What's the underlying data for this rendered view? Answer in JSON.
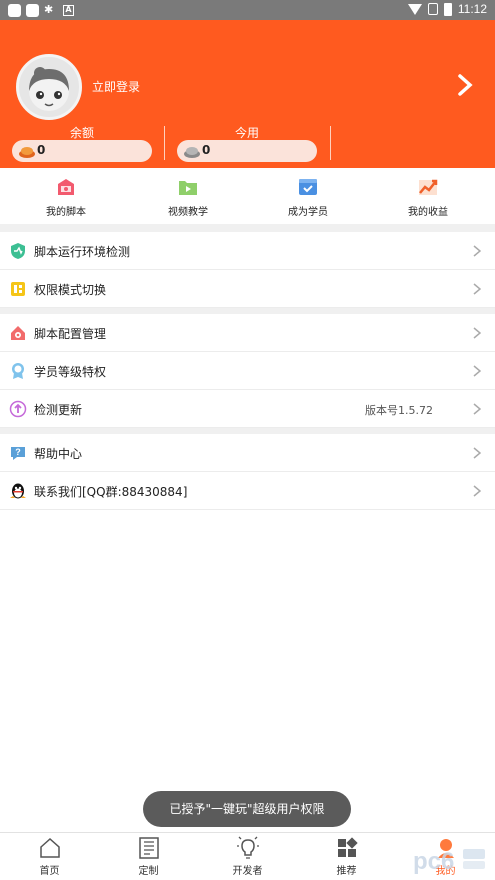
{
  "status_bar": {
    "time": "11:12"
  },
  "header": {
    "login_text": "立即登录",
    "stats": [
      {
        "label": "余额",
        "value": "0"
      },
      {
        "label": "今用",
        "value": "0"
      }
    ],
    "colors": {
      "accent": "#ff5a1f"
    }
  },
  "quick_actions": [
    {
      "label": "我的脚本",
      "icon": "script-bag-icon"
    },
    {
      "label": "视频教学",
      "icon": "video-folder-icon"
    },
    {
      "label": "成为学员",
      "icon": "member-card-icon"
    },
    {
      "label": "我的收益",
      "icon": "earnings-chart-icon"
    }
  ],
  "menu": {
    "group1": [
      {
        "label": "脚本运行环境检测",
        "icon": "shield-check-icon"
      },
      {
        "label": "权限模式切换",
        "icon": "permission-switch-icon"
      }
    ],
    "group2": [
      {
        "label": "脚本配置管理",
        "icon": "config-house-icon"
      },
      {
        "label": "学员等级特权",
        "icon": "badge-icon"
      },
      {
        "label": "检测更新",
        "icon": "update-icon",
        "value": "版本号1.5.72"
      }
    ],
    "group3": [
      {
        "label": "帮助中心",
        "icon": "help-icon"
      },
      {
        "label": "联系我们[QQ群:88430884]",
        "icon": "qq-penguin-icon"
      }
    ]
  },
  "toast": {
    "text": "已授予\"一键玩\"超级用户权限"
  },
  "bottom_nav": [
    {
      "label": "首页",
      "icon": "home-icon"
    },
    {
      "label": "定制",
      "icon": "book-icon"
    },
    {
      "label": "开发者",
      "icon": "lightbulb-icon"
    },
    {
      "label": "推荐",
      "icon": "apps-grid-icon"
    },
    {
      "label": "我的",
      "icon": "profile-icon",
      "active": true
    }
  ]
}
